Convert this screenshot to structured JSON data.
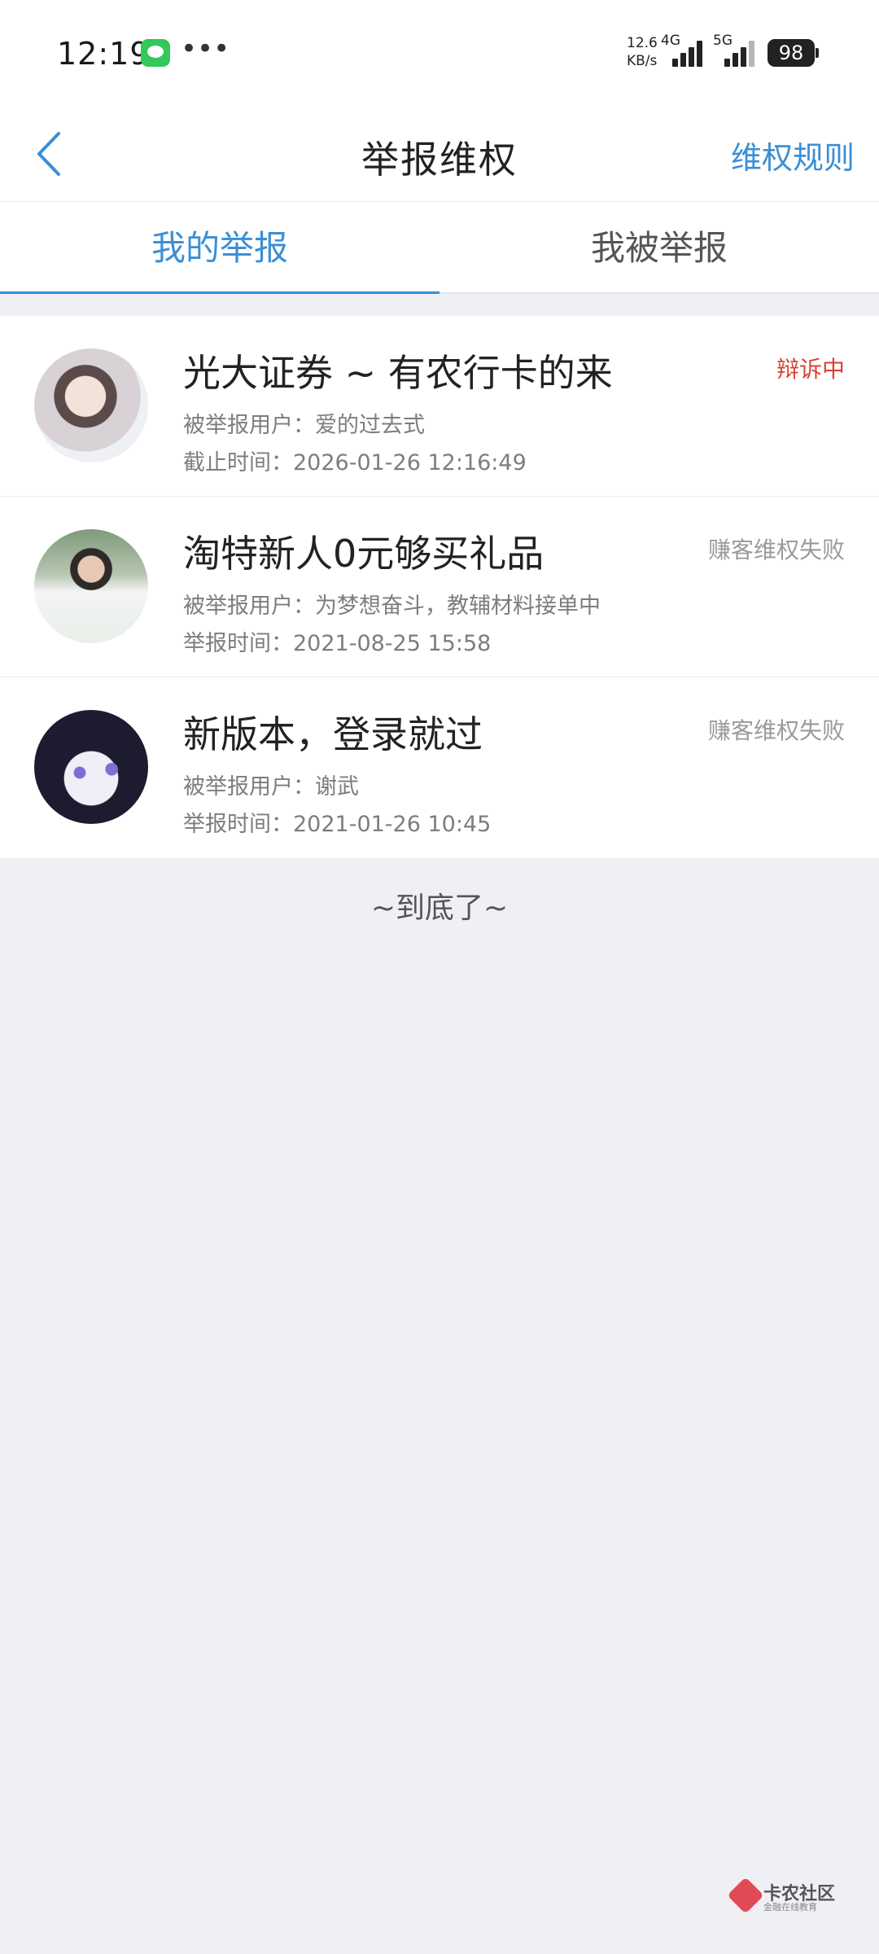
{
  "status_bar": {
    "time": "12:19",
    "dots": "•••",
    "speed_value": "12.6",
    "speed_unit": "KB/s",
    "net1": "4G",
    "net2": "5G",
    "battery": "98",
    "icons": [
      "message-icon",
      "signal-icon",
      "battery-icon"
    ]
  },
  "nav": {
    "title": "举报维权",
    "rules_label": "维权规则",
    "back_icon": "chevron-left-icon"
  },
  "tabs": [
    {
      "label": "我的举报",
      "active": true
    },
    {
      "label": "我被举报",
      "active": false
    }
  ],
  "reports": [
    {
      "title": "光大证券 ~ 有农行卡的来",
      "status": "辩诉中",
      "status_color": "#d64336",
      "line1": "被举报用户：爱的过去式",
      "line2": "截止时间：2026-01-26 12:16:49"
    },
    {
      "title": "淘特新人0元够买礼品",
      "status": "赚客维权失败",
      "status_color": "#9a9a9a",
      "line1": "被举报用户：为梦想奋斗，教辅材料接单中",
      "line2": "举报时间：2021-08-25 15:58"
    },
    {
      "title": "新版本，登录就过",
      "status": "赚客维权失败",
      "status_color": "#9a9a9a",
      "line1": "被举报用户：谢武",
      "line2": "举报时间：2021-01-26 10:45"
    }
  ],
  "end_text": "~到底了~",
  "watermark": {
    "name": "卡农社区",
    "subtitle": "金融在线教育"
  },
  "colors": {
    "accent": "#3b8fd4",
    "alert": "#d64336",
    "background": "#efeff4"
  }
}
